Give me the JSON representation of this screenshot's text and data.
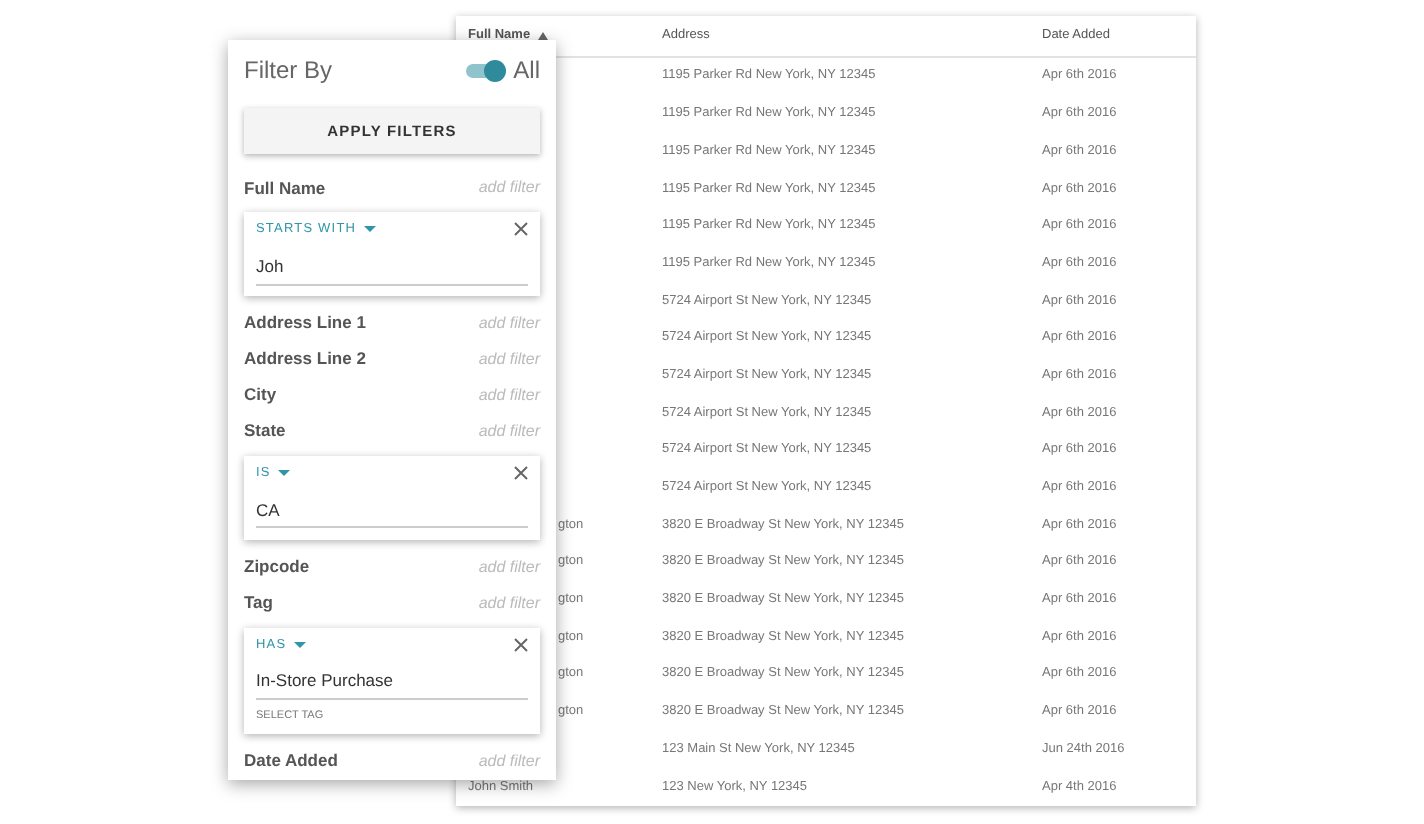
{
  "table": {
    "columns": [
      {
        "label": "Full Name",
        "sorted": true
      },
      {
        "label": "Address",
        "sorted": false
      },
      {
        "label": "Date Added",
        "sorted": false
      }
    ],
    "rows": [
      {
        "address": "1195 Parker Rd New York, NY 12345",
        "date": "Apr 6th 2016"
      },
      {
        "address": "1195 Parker Rd New York, NY 12345",
        "date": "Apr 6th 2016"
      },
      {
        "address": "1195 Parker Rd New York, NY 12345",
        "date": "Apr 6th 2016"
      },
      {
        "address": "1195 Parker Rd New York, NY 12345",
        "date": "Apr 6th 2016"
      },
      {
        "address": "1195 Parker Rd New York, NY 12345",
        "date": "Apr 6th 2016"
      },
      {
        "address": "1195 Parker Rd New York, NY 12345",
        "date": "Apr 6th 2016"
      },
      {
        "address": "5724 Airport St New York, NY 12345",
        "date": "Apr 6th 2016"
      },
      {
        "address": "5724 Airport St New York, NY 12345",
        "date": "Apr 6th 2016"
      },
      {
        "address": "5724 Airport St New York, NY 12345",
        "date": "Apr 6th 2016"
      },
      {
        "address": "5724 Airport St New York, NY 12345",
        "date": "Apr 6th 2016"
      },
      {
        "address": "5724 Airport St New York, NY 12345",
        "date": "Apr 6th 2016"
      },
      {
        "address": "5724 Airport St New York, NY 12345",
        "date": "Apr 6th 2016"
      },
      {
        "name": "gton",
        "name_cut": true,
        "address": "3820 E Broadway St New York, NY 12345",
        "date": "Apr 6th 2016"
      },
      {
        "name": "gton",
        "name_cut": true,
        "address": "3820 E Broadway St New York, NY 12345",
        "date": "Apr 6th 2016"
      },
      {
        "name": "gton",
        "name_cut": true,
        "address": "3820 E Broadway St New York, NY 12345",
        "date": "Apr 6th 2016"
      },
      {
        "name": "gton",
        "name_cut": true,
        "address": "3820 E Broadway St New York, NY 12345",
        "date": "Apr 6th 2016"
      },
      {
        "name": "gton",
        "name_cut": true,
        "address": "3820 E Broadway St New York, NY 12345",
        "date": "Apr 6th 2016"
      },
      {
        "name": "gton",
        "name_cut": true,
        "address": "3820 E Broadway St New York, NY 12345",
        "date": "Apr 6th 2016"
      },
      {
        "address": "123 Main St New York, NY 12345",
        "date": "Jun 24th 2016"
      },
      {
        "name": "John Smith",
        "name_cut": false,
        "address": "123 New York, NY 12345",
        "date": "Apr 4th 2016"
      }
    ]
  },
  "filter_panel": {
    "title": "Filter By",
    "toggle": {
      "label": "All",
      "on": true
    },
    "apply_button": "APPLY FILTERS",
    "fields": [
      {
        "label": "Full Name",
        "action": "add filter",
        "filter": {
          "operator": "STARTS WITH",
          "value": "Joh"
        }
      },
      {
        "label": "Address Line 1",
        "action": "add filter"
      },
      {
        "label": "Address Line 2",
        "action": "add filter"
      },
      {
        "label": "City",
        "action": "add filter"
      },
      {
        "label": "State",
        "action": "add filter",
        "filter": {
          "operator": "IS",
          "value": "CA"
        }
      },
      {
        "label": "Zipcode",
        "action": "add filter"
      },
      {
        "label": "Tag",
        "action": "add filter",
        "filter": {
          "operator": "HAS",
          "value": "In-Store Purchase",
          "hint": "SELECT TAG"
        }
      },
      {
        "label": "Date Added",
        "action": "add filter"
      }
    ]
  }
}
